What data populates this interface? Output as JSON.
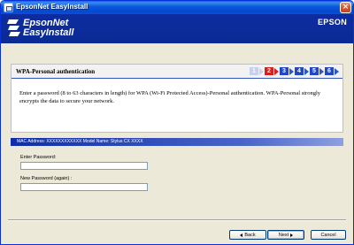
{
  "window": {
    "title": "EpsonNet EasyInstall",
    "close_glyph": "×"
  },
  "banner": {
    "logo_line1": "EpsonNet",
    "logo_line2": "EasyInstall",
    "brand": "EPSON"
  },
  "step_panel": {
    "title": "WPA-Personal authentication",
    "steps": [
      "1",
      "2",
      "3",
      "4",
      "5",
      "6"
    ],
    "current_step": 2,
    "description": "Enter a password (8 to 63 characters in length) for WPA (Wi-Fi Protected Access)-Personal authentication. WPA-Personal strongly encrypts the data to secure your network."
  },
  "info_bar": {
    "text": "MAC Address: XXXXXXXXXXXX  Model Name: Stylus CX XXXX"
  },
  "form": {
    "password_label": "Enter Password:",
    "password_value": "",
    "confirm_label": "New Password (again) :",
    "confirm_value": ""
  },
  "buttons": {
    "back": "Back",
    "next": "Next",
    "cancel": "Cancel"
  },
  "colors": {
    "banner_bg": "#0a2b94",
    "accent_blue": "#2347c0",
    "current_step": "#d62020",
    "xp_title": "#0a57d8"
  },
  "icons": {
    "app": "app-icon",
    "close": "close-icon",
    "logo": "epsonnet-logo-icon"
  }
}
